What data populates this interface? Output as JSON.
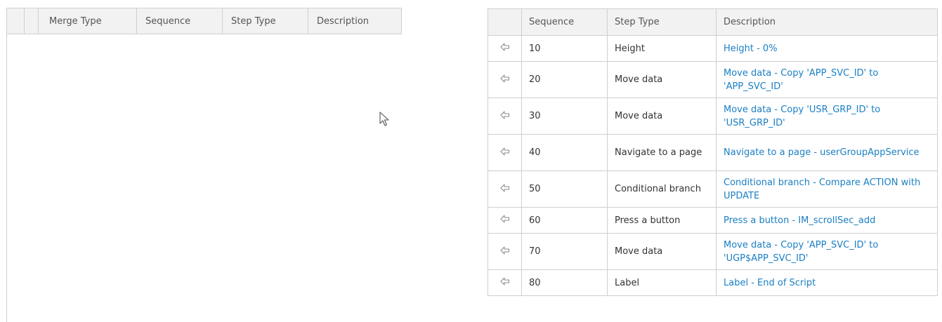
{
  "left_grid": {
    "columns": [
      "",
      "",
      "Merge Type",
      "Sequence",
      "Step Type",
      "Description"
    ]
  },
  "right_grid": {
    "columns": [
      "",
      "Sequence",
      "Step Type",
      "Description"
    ],
    "rows": [
      {
        "icon": "arrow-left-icon",
        "sequence": "10",
        "step_type": "Height",
        "description": "Height - 0%"
      },
      {
        "icon": "arrow-left-icon",
        "sequence": "20",
        "step_type": "Move data",
        "description": "Move data - Copy 'APP_SVC_ID' to 'APP_SVC_ID'"
      },
      {
        "icon": "arrow-left-icon",
        "sequence": "30",
        "step_type": "Move data",
        "description": "Move data - Copy 'USR_GRP_ID' to 'USR_GRP_ID'"
      },
      {
        "icon": "arrow-left-icon",
        "sequence": "40",
        "step_type": "Navigate to a page",
        "description": "Navigate to a page - userGroupAppService"
      },
      {
        "icon": "arrow-left-icon",
        "sequence": "50",
        "step_type": "Conditional branch",
        "description": "Conditional branch - Compare ACTION with UPDATE"
      },
      {
        "icon": "arrow-left-icon",
        "sequence": "60",
        "step_type": "Press a button",
        "description": "Press a button - IM_scrollSec_add"
      },
      {
        "icon": "arrow-left-icon",
        "sequence": "70",
        "step_type": "Move data",
        "description": "Move data - Copy 'APP_SVC_ID' to 'UGP$APP_SVC_ID'"
      },
      {
        "icon": "arrow-left-icon",
        "sequence": "80",
        "step_type": "Label",
        "description": "Label - End of Script"
      }
    ]
  },
  "colors": {
    "link": "#1a7fc4",
    "header_bg": "#f2f2f2",
    "border": "#cfcfcf"
  },
  "cursor": {
    "icon": "mouse-pointer-icon"
  }
}
